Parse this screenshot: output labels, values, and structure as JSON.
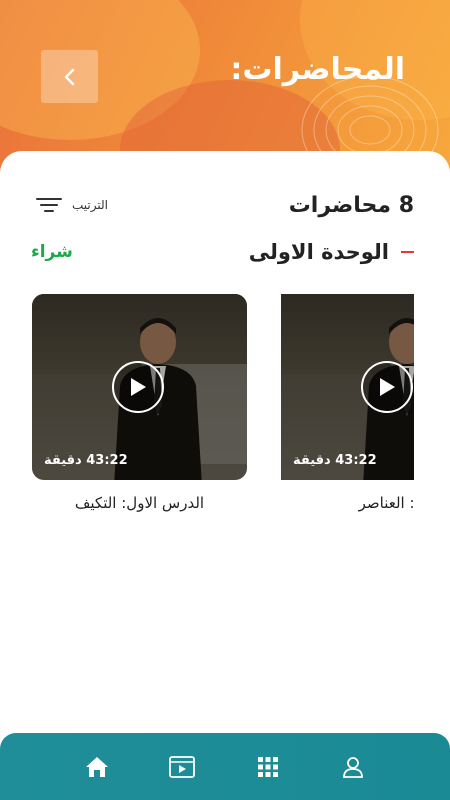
{
  "header": {
    "title": "المحاضرات:",
    "back_icon": "chevron-left-icon"
  },
  "list": {
    "count_title": "8 محاضرات",
    "sort_label": "الترتيب",
    "sort_icon": "filter-lines-icon"
  },
  "unit": {
    "title": "الوحدة الاولى",
    "buy_label": "شراء",
    "buy_color": "#1ea84a",
    "marker_color": "#e53935"
  },
  "lectures": [
    {
      "duration": "43:22 دقيقة",
      "title": "الدرس الاول: التكيف"
    },
    {
      "duration": "43:22 دقيقة",
      "title": "الدرس الثاني: العناصر"
    }
  ],
  "bottom_nav": {
    "items": [
      {
        "icon": "home-icon"
      },
      {
        "icon": "video-icon"
      },
      {
        "icon": "grid-icon"
      },
      {
        "icon": "user-icon"
      }
    ]
  },
  "colors": {
    "header_orange": "#f08a3a",
    "nav_teal": "#1f8e98"
  }
}
